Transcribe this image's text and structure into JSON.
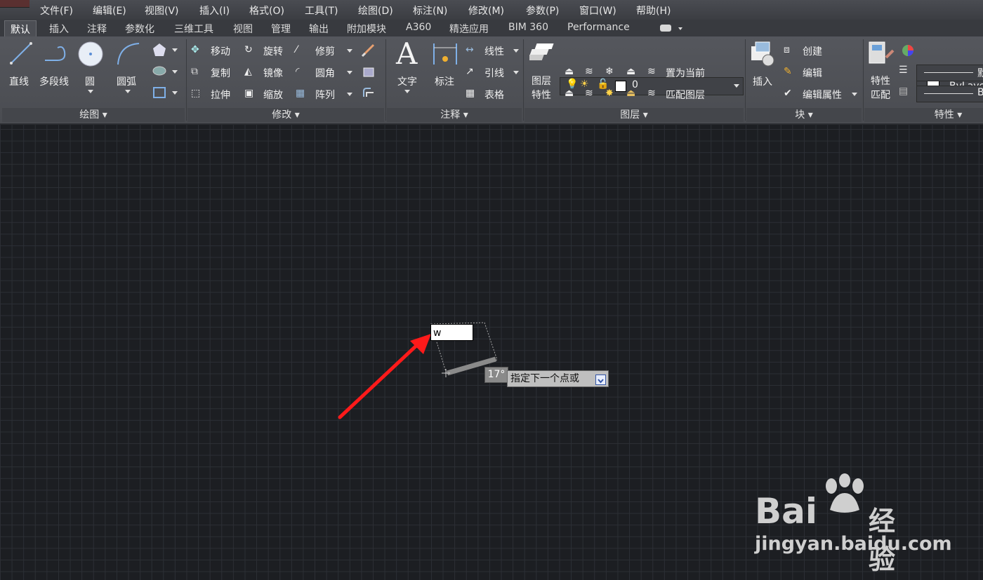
{
  "menus": [
    "文件(F)",
    "编辑(E)",
    "视图(V)",
    "插入(I)",
    "格式(O)",
    "工具(T)",
    "绘图(D)",
    "标注(N)",
    "修改(M)",
    "参数(P)",
    "窗口(W)",
    "帮助(H)"
  ],
  "tabs": [
    "默认",
    "插入",
    "注释",
    "参数化",
    "三维工具",
    "视图",
    "管理",
    "输出",
    "附加模块",
    "A360",
    "精选应用",
    "BIM 360",
    "Performance"
  ],
  "ribbon": {
    "draw": {
      "line": "直线",
      "polyline": "多段线",
      "circle": "圆",
      "arc": "圆弧",
      "label": "绘图"
    },
    "modify": {
      "move": "移动",
      "rotate": "旋转",
      "trim": "修剪",
      "copy": "复制",
      "mirror": "镜像",
      "fillet": "圆角",
      "stretch": "拉伸",
      "scale": "缩放",
      "array": "阵列",
      "label": "修改"
    },
    "annotation": {
      "text": "文字",
      "dimension": "标注",
      "linear": "线性",
      "leader": "引线",
      "table": "表格",
      "label": "注释"
    },
    "layers": {
      "properties_line1": "图层",
      "properties_line2": "特性",
      "current_layer": "0",
      "set_current": "置为当前",
      "match_layer": "匹配图层",
      "label": "图层"
    },
    "block": {
      "insert": "插入",
      "create": "创建",
      "edit": "编辑",
      "edit_attributes": "编辑属性",
      "label": "块"
    },
    "properties": {
      "match_line1": "特性",
      "match_line2": "匹配",
      "bylayer": "ByLaye",
      "linetype_end": "默",
      "lineweight_end": "B",
      "label": "特性"
    }
  },
  "drawing": {
    "input_value": "w",
    "angle": "17°",
    "prompt": "指定下一个点或"
  },
  "watermark": {
    "brand": "Bai",
    "brand_tail": "经验",
    "url": "jingyan.baidu.com"
  },
  "colors": {
    "arrow": "#ff1a1a",
    "canvas": "#1c1e22",
    "ribbon": "#4f5156"
  }
}
